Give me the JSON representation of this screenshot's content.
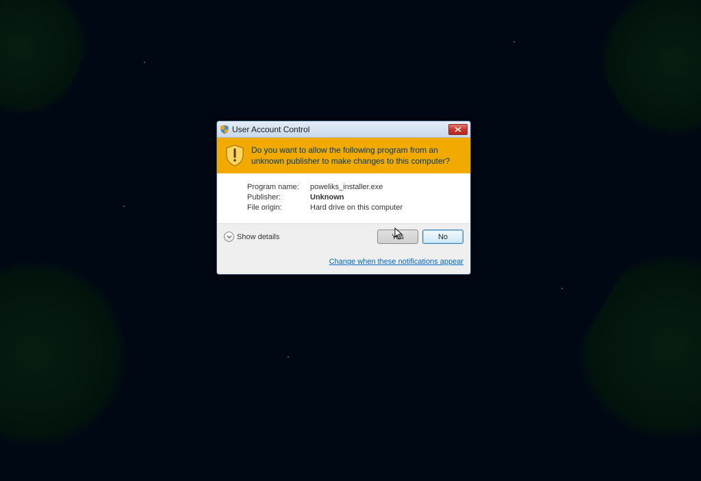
{
  "window": {
    "title": "User Account Control"
  },
  "banner": {
    "question": "Do you want to allow the following program from an unknown publisher to make changes to this computer?"
  },
  "details": {
    "program_label": "Program name:",
    "program_value": "poweliks_installer.exe",
    "publisher_label": "Publisher:",
    "publisher_value": "Unknown",
    "origin_label": "File origin:",
    "origin_value": "Hard drive on this computer"
  },
  "footer": {
    "show_details": "Show details",
    "yes": "Yes",
    "no": "No",
    "link": "Change when these notifications appear"
  }
}
